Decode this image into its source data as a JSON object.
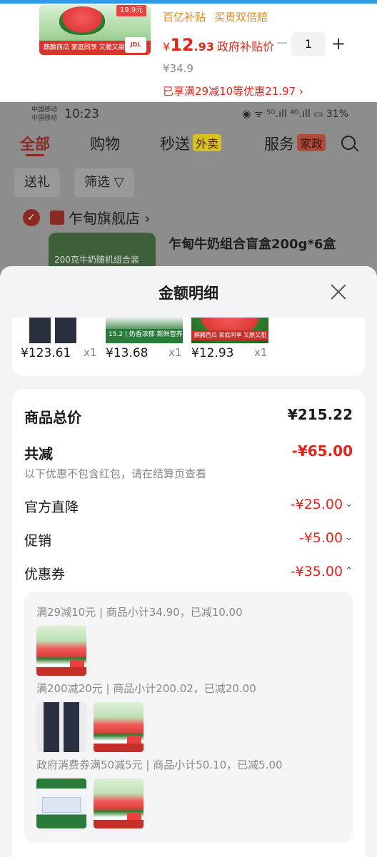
{
  "cart_item": {
    "tags": [
      "百亿补贴",
      "买贵双倍赔"
    ],
    "price_symbol": "¥",
    "price_int": "12",
    "price_dec": ".93",
    "gov_label": "政府补贴价",
    "qty": "1",
    "minus": "−",
    "plus": "+",
    "orig_price": "¥34.9",
    "discount_text": "已享满29减10等优惠21.97 ›",
    "thumb_price": "19.9元",
    "thumb_band": "麒麟西瓜 家庭同享 又脆又甜",
    "thumb_logo": "JDL"
  },
  "status_bar": {
    "carrier1": "中国移动",
    "carrier2": "中国移动",
    "time": "10:23",
    "right": "◉ ᯤ ⁵ᴳ.ıll ⁴ᴳ.ıll ▭ 31%"
  },
  "nav": {
    "tabs": [
      "全部",
      "购物",
      "秒送",
      "服务"
    ],
    "badges": [
      "外卖",
      "家政"
    ]
  },
  "chips": [
    "送礼",
    "筛选 ▽"
  ],
  "shop": {
    "check": "✓",
    "name": "乍甸旗舰店 ›"
  },
  "product": {
    "title": "乍甸牛奶组合盲盒200g*6盒",
    "thumb_text": "200克牛奶随机组合装"
  },
  "sheet": {
    "title": "金额明细",
    "items": [
      {
        "price": "¥123.61",
        "qty": "x1"
      },
      {
        "price": "¥13.68",
        "qty": "x1",
        "img_text": "15.2 | 奶香浓郁 新鲜营养"
      },
      {
        "price": "¥12.93",
        "qty": "x1",
        "img_text": "麒麟西瓜 家庭同享 又脆又甜 JDL"
      }
    ],
    "summary": {
      "total_label": "商品总价",
      "total_value": "¥215.22",
      "discount_label": "共减",
      "discount_value": "-¥65.00",
      "note": "以下优惠不包含红包，请在结算页查看",
      "official_label": "官方直降",
      "official_value": "-¥25.00",
      "promo_label": "促销",
      "promo_value": "-¥5.00",
      "coupon_label": "优惠券",
      "coupon_value": "-¥35.00"
    },
    "coupons": [
      {
        "text": "满29减10元 | 商品小计34.90，已减10.00"
      },
      {
        "text": "满200减20元 | 商品小计200.02，已减20.00"
      },
      {
        "text": "政府消费券满50减5元 | 商品小计50.10，已减5.00"
      }
    ],
    "chevron_down": "⌄",
    "chevron_up": "⌃"
  },
  "colors": {
    "accent_red": "#e1251b",
    "tag_orange": "#e08a1e",
    "top_line": "#2e9be8"
  }
}
